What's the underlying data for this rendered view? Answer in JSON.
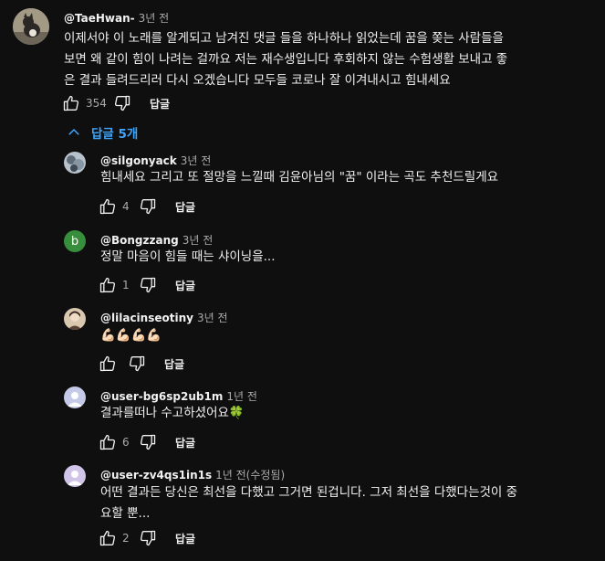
{
  "comment": {
    "author": "@TaeHwan-",
    "time": "3년 전",
    "text_lines": [
      "이제서야 이 노래를 알게되고 남겨진 댓글 들을 하나하나 읽었는데 꿈을 쫒는 사람들을",
      "보면 왜 같이 힘이 나려는 걸까요 저는 재수생입니다 후회하지 않는 수험생활 보내고 좋",
      "은 결과 들려드리러 다시 오겠습니다 모두들 코로나 잘 이겨내시고 힘내세요"
    ],
    "likes": "354",
    "reply_label": "답글"
  },
  "replies_toggle": {
    "label": "답글 5개",
    "icon": "chevron-up-icon"
  },
  "colors": {
    "accent": "#3ea6ff",
    "bg": "#0f0f0f",
    "text": "#f1f1f1",
    "muted": "#aaaaaa"
  },
  "replies": [
    {
      "author": "@silgonyack",
      "time": "3년 전",
      "text_lines": [
        "힘내세요 그리고 또 절망을 느낄때 김윤아님의 \"꿈\" 이라는 곡도 추천드릴게요"
      ],
      "likes": "4",
      "reply_label": "답글"
    },
    {
      "author": "@Bongzzang",
      "time": "3년 전",
      "avatar_letter": "b",
      "text_lines": [
        "정말 마음이 힘들 때는 샤이닝을..."
      ],
      "likes": "1",
      "reply_label": "답글"
    },
    {
      "author": "@lilacinseotiny",
      "time": "3년 전",
      "text_lines": [
        "💪🏻💪🏻💪🏻💪🏻"
      ],
      "likes": "",
      "reply_label": "답글"
    },
    {
      "author": "@user-bg6sp2ub1m",
      "time": "1년 전",
      "text_lines": [
        "결과를떠나 수고하셨어요🍀"
      ],
      "likes": "6",
      "reply_label": "답글"
    },
    {
      "author": "@user-zv4qs1in1s",
      "time": "1년 전(수정됨)",
      "text_lines": [
        "어떤 결과든 당신은 최선을 다했고 그거면 된겁니다. 그저 최선을 다했다는것이 중",
        "요할 뿐..."
      ],
      "likes": "2",
      "reply_label": "답글"
    }
  ]
}
